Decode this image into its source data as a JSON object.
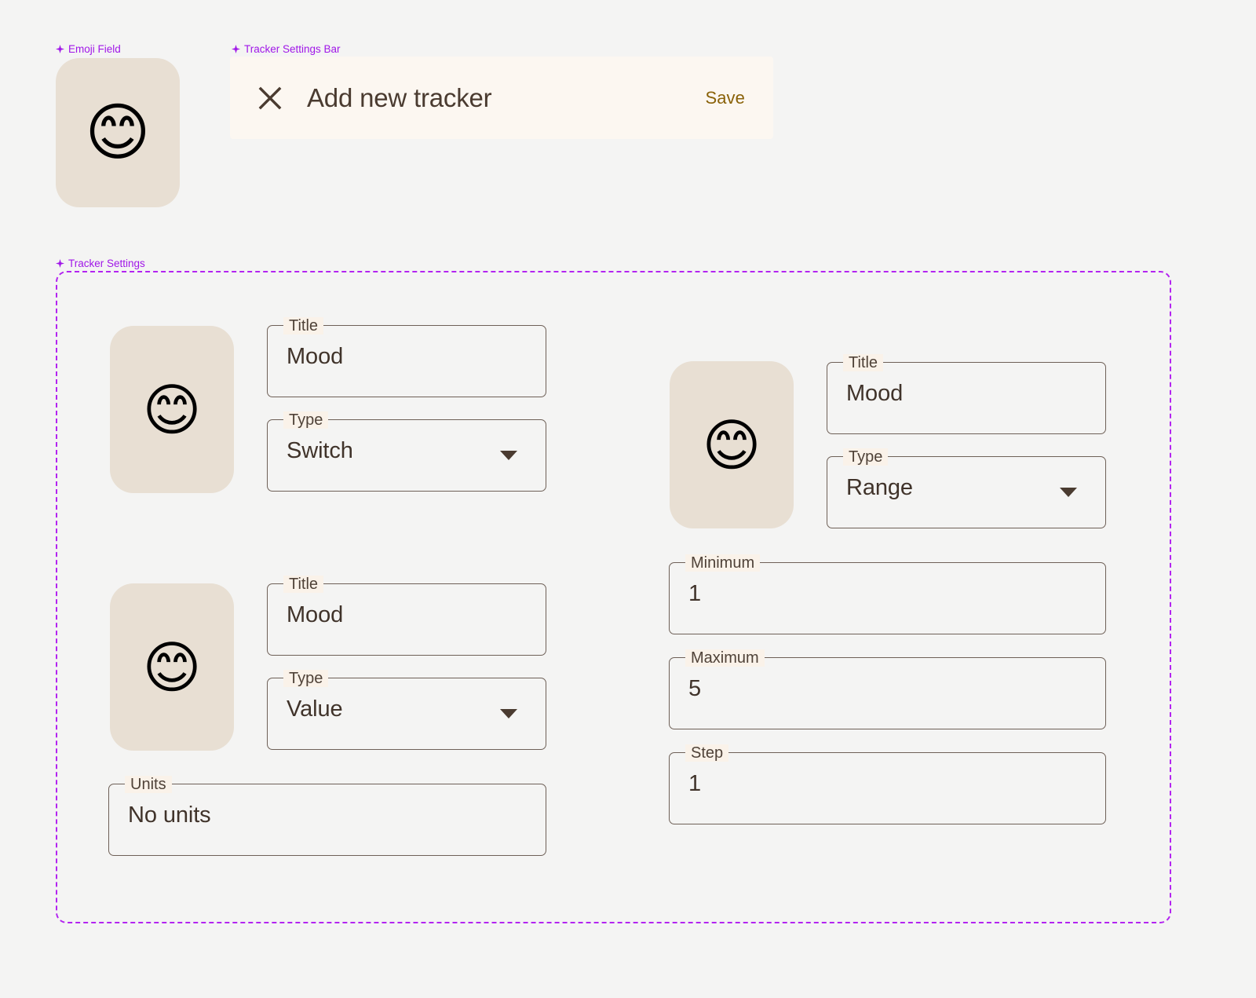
{
  "page": {
    "background_color": "#f4f4f3",
    "accent_purple": "#a016e8",
    "field_border_color": "#6e6057",
    "tile_color": "#e8dfd3",
    "bar_background": "#fcf7f1",
    "save_color": "#8a6209",
    "text_color": "#40332a"
  },
  "annotations": {
    "emoji_field": "Emoji Field",
    "tracker_settings_bar": "Tracker Settings Bar",
    "tracker_settings": "Tracker Settings",
    "sparkle_icon": "sparkle-icon"
  },
  "emoji_field": {
    "emoji": "😊",
    "icon_name": "smiling-face-with-smiling-eyes-emoji"
  },
  "settings_bar": {
    "close_icon": "close-x-icon",
    "title": "Add new tracker",
    "save_label": "Save"
  },
  "tracker_settings": {
    "cards": [
      {
        "id": "switch-tracker",
        "emoji": "😊",
        "fields": [
          {
            "label": "Title",
            "value": "Mood",
            "type": "text"
          },
          {
            "label": "Type",
            "value": "Switch",
            "type": "select"
          }
        ]
      },
      {
        "id": "range-tracker",
        "emoji": "😊",
        "fields": [
          {
            "label": "Title",
            "value": "Mood",
            "type": "text"
          },
          {
            "label": "Type",
            "value": "Range",
            "type": "select"
          },
          {
            "label": "Minimum",
            "value": "1",
            "type": "text"
          },
          {
            "label": "Maximum",
            "value": "5",
            "type": "text"
          },
          {
            "label": "Step",
            "value": "1",
            "type": "text"
          }
        ]
      },
      {
        "id": "value-tracker",
        "emoji": "😊",
        "fields": [
          {
            "label": "Title",
            "value": "Mood",
            "type": "text"
          },
          {
            "label": "Type",
            "value": "Value",
            "type": "select"
          },
          {
            "label": "Units",
            "value": "No units",
            "type": "text"
          }
        ]
      }
    ]
  }
}
